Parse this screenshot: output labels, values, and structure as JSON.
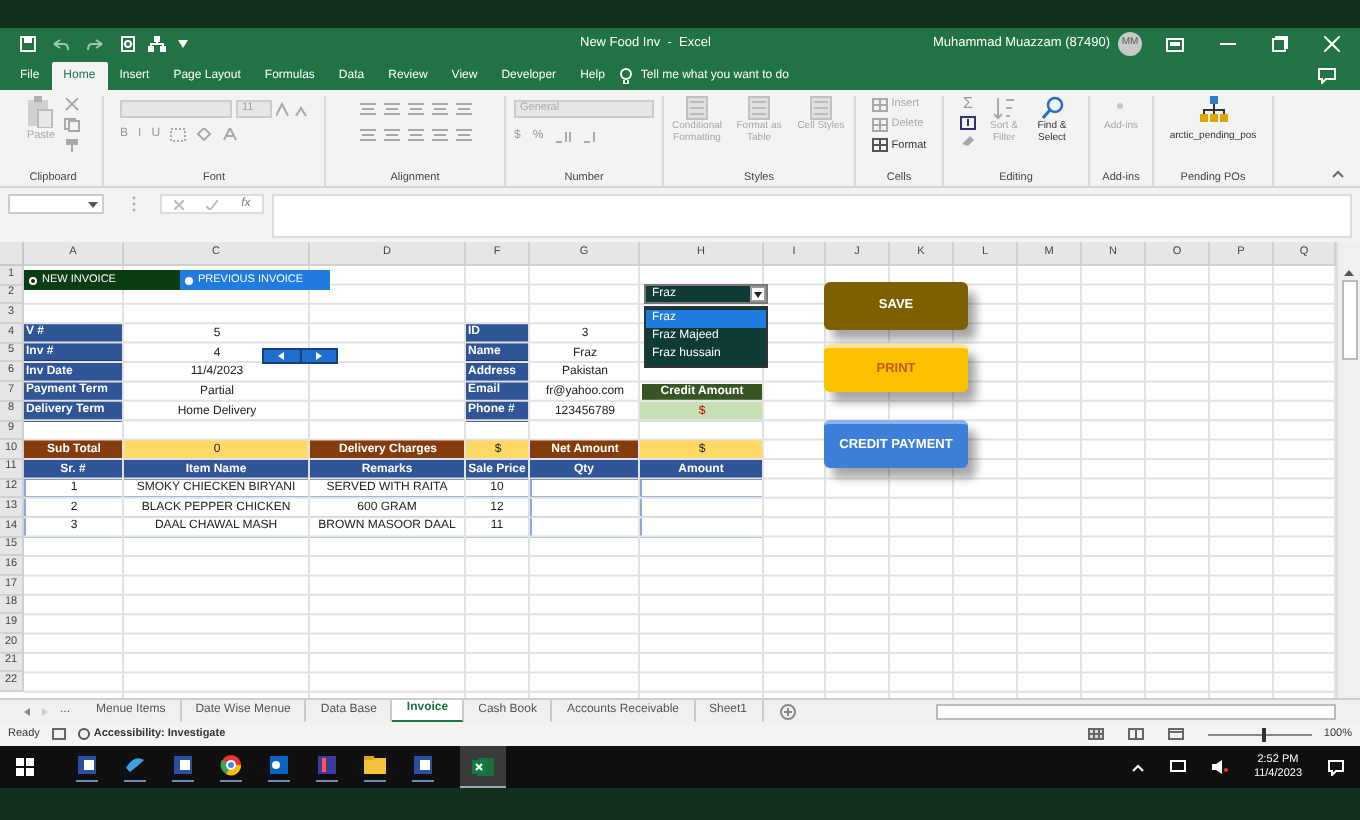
{
  "title_bar": {
    "title": "New Food Inv  -  Excel",
    "user": "Muhammad Muazzam (87490)",
    "avatar": "MM"
  },
  "ribbon_tabs": [
    {
      "label": "File",
      "selected": false
    },
    {
      "label": "Home",
      "selected": true
    },
    {
      "label": "Insert",
      "selected": false
    },
    {
      "label": "Page Layout",
      "selected": false
    },
    {
      "label": "Formulas",
      "selected": false
    },
    {
      "label": "Data",
      "selected": false
    },
    {
      "label": "Review",
      "selected": false
    },
    {
      "label": "View",
      "selected": false
    },
    {
      "label": "Developer",
      "selected": false
    },
    {
      "label": "Help",
      "selected": false
    }
  ],
  "tell_me": "Tell me what you want to do",
  "ribbon_groups": [
    {
      "kind": "clipboard",
      "label": "Clipboard",
      "commands": [
        {
          "label": "Paste",
          "disabled": true
        }
      ]
    },
    {
      "kind": "font",
      "label": "Font",
      "font_size": "11",
      "buttons": [
        "B",
        "I",
        "U"
      ]
    },
    {
      "kind": "alignment",
      "label": "Alignment"
    },
    {
      "kind": "number",
      "label": "Number",
      "format": "General",
      "buttons": [
        "$",
        "%"
      ]
    },
    {
      "kind": "styles",
      "label": "Styles",
      "commands": [
        {
          "label": "Conditional Formatting",
          "disabled": true
        },
        {
          "label": "Format as Table",
          "disabled": true
        },
        {
          "label": "Cell Styles",
          "disabled": true
        }
      ]
    },
    {
      "kind": "cells",
      "label": "Cells",
      "commands": [
        {
          "label": "Insert",
          "disabled": true
        },
        {
          "label": "Delete",
          "disabled": true
        },
        {
          "label": "Format",
          "disabled": false
        }
      ]
    },
    {
      "kind": "editing",
      "label": "Editing",
      "symbol": "Σ",
      "commands": [
        {
          "label": "Sort & Filter",
          "disabled": true
        },
        {
          "label": "Find & Select",
          "disabled": false
        }
      ]
    },
    {
      "kind": "addins",
      "label": "Add-ins",
      "commands": [
        {
          "label": "Add-ins",
          "disabled": true
        }
      ]
    },
    {
      "kind": "custom",
      "label": "Pending POs",
      "commands": [
        {
          "label": "arctic_pending_pos",
          "disabled": false
        }
      ]
    }
  ],
  "formula_bar": {
    "function_label": "fx"
  },
  "sheet": {
    "columns": [
      "A",
      "C",
      "D",
      "F",
      "G",
      "H",
      "I",
      "J",
      "K",
      "L",
      "M",
      "N",
      "O",
      "P",
      "Q"
    ],
    "row_numbers": [
      "1",
      "2",
      "3",
      "4",
      "5",
      "6",
      "7",
      "8",
      "9",
      "10",
      "11",
      "12",
      "13",
      "14",
      "15",
      "16",
      "17",
      "18",
      "19",
      "20",
      "21",
      "22"
    ],
    "radio_options": [
      {
        "label": "NEW INVOICE",
        "selected": true
      },
      {
        "label": "PREVIOUS INVOICE",
        "selected": false
      }
    ],
    "invoice_fields": [
      {
        "label": "V #",
        "value": "5"
      },
      {
        "label": "Inv #",
        "value": "4"
      },
      {
        "label": "Inv Date",
        "value": "11/4/2023"
      },
      {
        "label": "Payment Term",
        "value": "Partial"
      },
      {
        "label": "Delivery Term",
        "value": "Home Delivery"
      }
    ],
    "customer_fields": [
      {
        "label": "ID",
        "value": "3"
      },
      {
        "label": "Name",
        "value": "Fraz"
      },
      {
        "label": "Address",
        "value": "Pakistan"
      },
      {
        "label": "Email",
        "value": "fr@yahoo.com"
      },
      {
        "label": "Phone #",
        "value": "123456789"
      }
    ],
    "customer_dropdown": {
      "value": "Fraz",
      "options": [
        {
          "label": "Fraz",
          "selected": true
        },
        {
          "label": "Fraz Majeed",
          "selected": false
        },
        {
          "label": "Fraz hussain",
          "selected": false
        }
      ]
    },
    "credit_amount": {
      "label": "Credit Amount",
      "value": "$"
    },
    "totals": [
      {
        "label": "Sub Total",
        "value": "0"
      },
      {
        "label": "Delivery Charges",
        "value": "$"
      },
      {
        "label": "Net Amount",
        "value": "$"
      }
    ],
    "items_table": {
      "columns": [
        "Sr. #",
        "Item Name",
        "Remarks",
        "Sale Price",
        "Qty",
        "Amount"
      ],
      "rows": [
        {
          "sr": "1",
          "item": "SMOKY CHIECKEN BIRYANI",
          "remarks": "SERVED WITH RAITA",
          "sale_price": "10"
        },
        {
          "sr": "2",
          "item": "BLACK PEPPER CHICKEN",
          "remarks": "600 GRAM",
          "sale_price": "12"
        },
        {
          "sr": "3",
          "item": "DAAL CHAWAL MASH",
          "remarks": "BROWN MASOOR DAAL",
          "sale_price": "11"
        }
      ]
    },
    "buttons": [
      {
        "label": "SAVE",
        "kind": "save"
      },
      {
        "label": "PRINT",
        "kind": "print"
      },
      {
        "label": "CREDIT PAYMENT",
        "kind": "credit"
      }
    ]
  },
  "sheet_tabs": [
    {
      "label": "Menue Items",
      "selected": false
    },
    {
      "label": "Date Wise Menue",
      "selected": false
    },
    {
      "label": "Data Base",
      "selected": false
    },
    {
      "label": "Invoice",
      "selected": true
    },
    {
      "label": "Cash Book",
      "selected": false
    },
    {
      "label": "Accounts Receivable",
      "selected": false
    },
    {
      "label": "Sheet1",
      "selected": false
    }
  ],
  "sheet_nav": "...",
  "status_bar": {
    "mode": "Ready",
    "accessibility": "Accessibility: Investigate",
    "zoom": "100%",
    "zoom_slider": {
      "level": 0.55
    }
  },
  "taskbar": {
    "time": "2:52 PM",
    "date": "11/4/2023"
  }
}
